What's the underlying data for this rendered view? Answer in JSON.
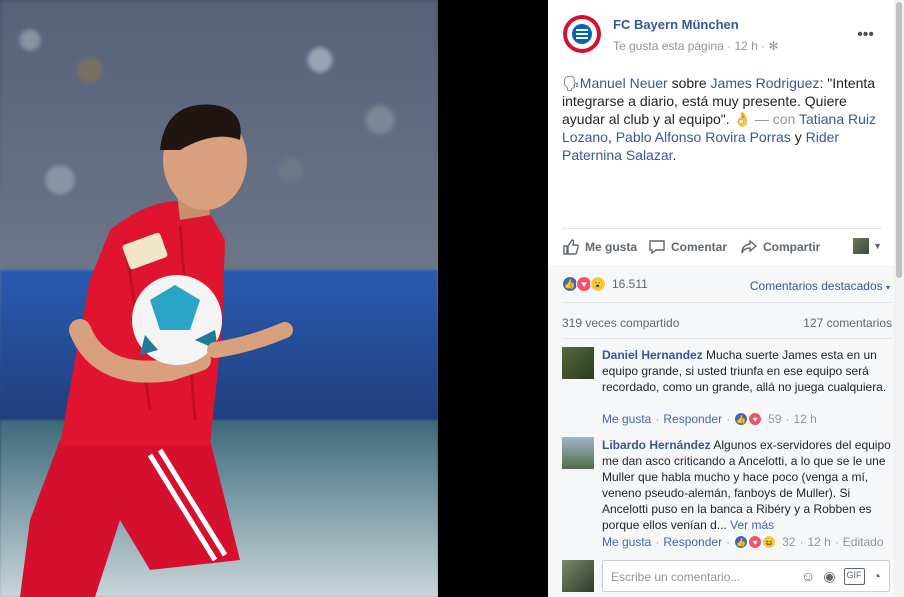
{
  "post": {
    "page_name": "FC Bayern München",
    "meta_like": "Te gusta esta página",
    "meta_sep": "·",
    "meta_time": "12 h",
    "meta_sep2": "·",
    "gear_icon": "gear-icon",
    "more_label": "•••",
    "text_parts": {
      "p1": "Manuel Neuer",
      "p2": " sobre ",
      "p3": "James Rodriguez",
      "p4": ": \"Intenta integrarse a diario, está muy presente. Quiere ayudar al club y al equipo\". ",
      "p5": "— con ",
      "p6": "Tatiana Ruiz Lozano",
      "p7": ", ",
      "p8": "Pablo Alfonso Rovira Porras",
      "p9": " y ",
      "p10": "Rider Paternina Salazar",
      "p11": "."
    },
    "actions": {
      "like": "Me gusta",
      "comment": "Comentar",
      "share": "Compartir"
    },
    "reactions_count": "16.511",
    "sort_label": "Comentarios destacados",
    "shares": "319 veces compartido",
    "comments_count": "127 comentarios"
  },
  "comments": [
    {
      "name": "Daniel Hernandez",
      "text": "Mucha suerte James esta en un equipo grande, si usted triunfa en ese equipo será recordado, como un grande, allá no juega cualquiera.",
      "like": "Me gusta",
      "reply": "Responder",
      "reactions": "59",
      "time": "12 h",
      "edited": ""
    },
    {
      "name": "Libardo Hernández",
      "text": "Algunos ex-servidores del equipo me dan asco criticando a Ancelotti, a lo que se le une Muller que habla mucho y hace poco (venga a mí, veneno pseudo-alemán, fanboys de Muller). Si Ancelotti puso en la banca a Ribéry y a Robben es porque ellos venían d...",
      "see_more": "Ver más",
      "like": "Me gusta",
      "reply": "Responder",
      "reactions": "32",
      "time": "12 h",
      "edited": "Editado"
    }
  ],
  "composer": {
    "placeholder": "Escribe un comentario..."
  },
  "colors": {
    "link": "#365899",
    "like_blue": "#4267b2",
    "love_red": "#f25268",
    "wow_yellow": "#fcc94d"
  }
}
